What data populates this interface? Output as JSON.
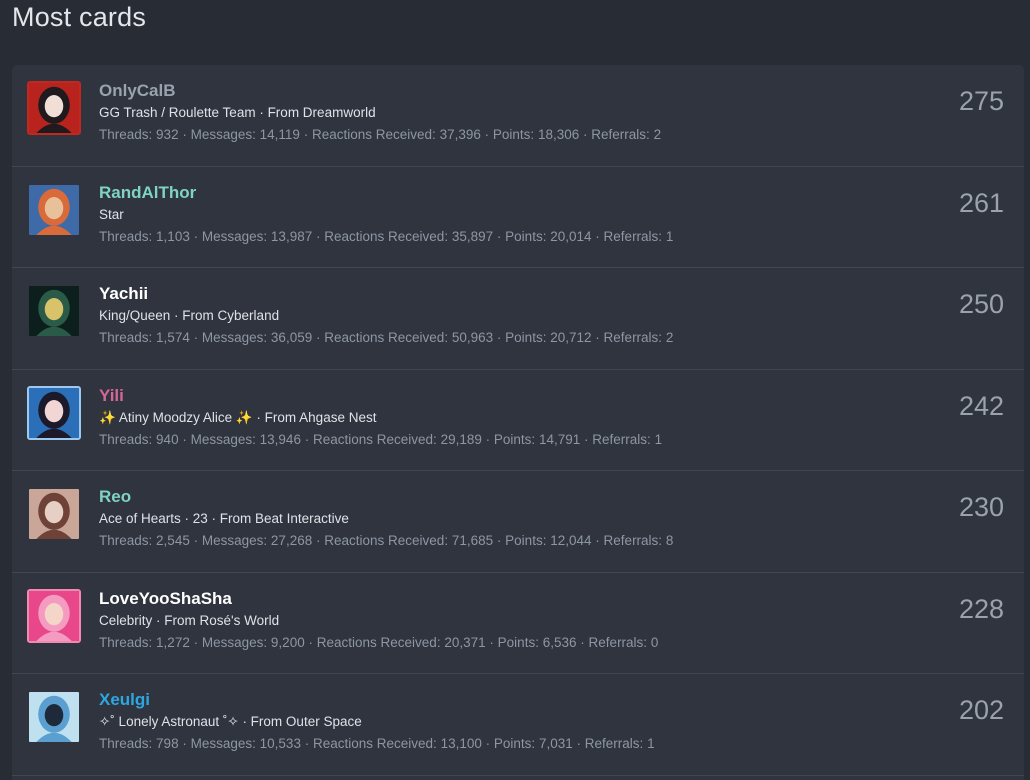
{
  "page": {
    "title": "Most cards"
  },
  "stat_labels": {
    "threads": "Threads:",
    "messages": "Messages:",
    "reactions": "Reactions Received:",
    "points": "Points:",
    "referrals": "Referrals:"
  },
  "members": [
    {
      "username": "OnlyCalB",
      "name_color": "#9aa2ae",
      "blurb": "GG Trash / Roulette Team · From Dreamworld",
      "threads": "932",
      "messages": "14,119",
      "reactions": "37,396",
      "points": "18,306",
      "referrals": "2",
      "count": "275",
      "avatar_colors": [
        "#b8231e",
        "#1e1a1d",
        "#f1ded6"
      ],
      "avatar_border": "#c4271f"
    },
    {
      "username": "RandAlThor",
      "name_color": "#7fd3c3",
      "blurb": "Star",
      "threads": "1,103",
      "messages": "13,987",
      "reactions": "35,897",
      "points": "20,014",
      "referrals": "1",
      "count": "261",
      "avatar_colors": [
        "#3e6aa8",
        "#d96a3a",
        "#e8c09a"
      ],
      "avatar_border": "#2f343f"
    },
    {
      "username": "Yachii",
      "name_color": "#ffffff",
      "blurb": "King/Queen · From Cyberland",
      "threads": "1,574",
      "messages": "36,059",
      "reactions": "50,963",
      "points": "20,712",
      "referrals": "2",
      "count": "250",
      "avatar_colors": [
        "#0d1f1c",
        "#2a5a48",
        "#d8c36a"
      ],
      "avatar_border": "#2f343f"
    },
    {
      "username": "Yili",
      "name_color": "#d4679a",
      "blurb": "✨ Atiny Moodzy Alice ✨ · From Ahgase Nest",
      "threads": "940",
      "messages": "13,946",
      "reactions": "29,189",
      "points": "14,791",
      "referrals": "1",
      "count": "242",
      "avatar_colors": [
        "#2a6fb8",
        "#1c1a2a",
        "#f2d6d6"
      ],
      "avatar_border": "#9ec8ee"
    },
    {
      "username": "Reo",
      "name_color": "#7fd3c3",
      "blurb": "Ace of Hearts · 23 · From Beat Interactive",
      "threads": "2,545",
      "messages": "27,268",
      "reactions": "71,685",
      "points": "12,044",
      "referrals": "8",
      "count": "230",
      "avatar_colors": [
        "#c9a698",
        "#6e4236",
        "#e6cfc4"
      ],
      "avatar_border": "#2f343f"
    },
    {
      "username": "LoveYooShaSha",
      "name_color": "#ffffff",
      "blurb": "Celebrity · From Rosé's World",
      "threads": "1,272",
      "messages": "9,200",
      "reactions": "20,371",
      "points": "6,536",
      "referrals": "0",
      "count": "228",
      "avatar_colors": [
        "#e8478a",
        "#f59ac0",
        "#f4d6c8"
      ],
      "avatar_border": "#f08ab0"
    },
    {
      "username": "Xeulgi",
      "name_color": "#2ea6e0",
      "blurb": "✧˚ Lonely Astronaut ˚✧ · From Outer Space",
      "threads": "798",
      "messages": "10,533",
      "reactions": "13,100",
      "points": "7,031",
      "referrals": "1",
      "count": "202",
      "avatar_colors": [
        "#bfe0ef",
        "#5a9fd0",
        "#1e2a3a"
      ],
      "avatar_border": "#2f343f"
    }
  ]
}
